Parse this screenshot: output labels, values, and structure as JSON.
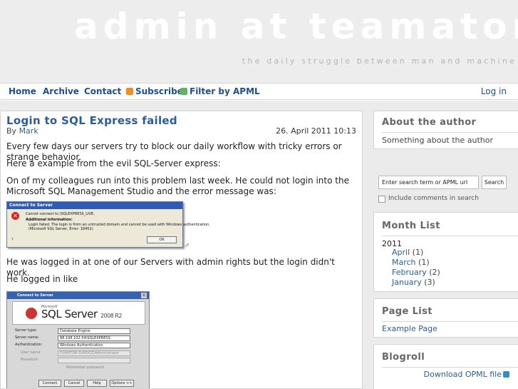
{
  "header": {
    "site_title": "admin at teamaton",
    "tagline": "the daily struggle between man and machine"
  },
  "nav": {
    "items": [
      "Home",
      "Archive",
      "Contact",
      "Subscribe",
      "Filter by APML"
    ],
    "login": "Log in"
  },
  "post": {
    "title": "Login to SQL Express failed",
    "by_label": "By",
    "author": "Mark",
    "date": "26. April 2011 10:13",
    "paragraphs": [
      "Every few days our servers try to block our daily workflow with tricky errors or strange behavior.",
      "Here a example from the evil SQL-Server express:",
      "On of my colleagues run into this problem last week. He could not login into the Microsoft SQL Management Studio and the error message was:",
      "He was logged in at one of our Servers with admin rights but the login didn't work.",
      "He logged in like"
    ],
    "screenshot1": {
      "title": "Connect to Server",
      "line1": "Cannot connect to \\SQLEXPRESS_LIVE.",
      "line2": "Additional information:",
      "line3": "Login failed. The login is from an untrusted domain and cannot be used with Windows authentication.",
      "line4": "(Microsoft SQL Server, Error: 18452)",
      "ok": "OK"
    },
    "screenshot2": {
      "title": "Connect to Server",
      "microsoft": "Microsoft",
      "product": "SQL Server",
      "version": "2008 R2",
      "rows": [
        {
          "label": "Server type:",
          "value": "Database Engine"
        },
        {
          "label": "Server name:",
          "value": "88.198.102.54\\SQLEXPRESS"
        },
        {
          "label": "Authentication:",
          "value": "Windows Authentication"
        },
        {
          "label": "User name:",
          "value": "DVANTOR-SVRDOZ\\Administrator"
        },
        {
          "label": "Password:",
          "value": ""
        },
        {
          "label": "Remember password",
          "value": ""
        }
      ],
      "buttons": [
        "Connect",
        "Cancel",
        "Help",
        "Options >>"
      ]
    }
  },
  "sidebar": {
    "about": {
      "title": "About the author",
      "text": "Something about the author"
    },
    "search": {
      "placeholder": "Enter search term or APML url",
      "button": "Search",
      "include_comments": "Include comments in search"
    },
    "month_list": {
      "title": "Month List",
      "year": "2011",
      "months": [
        {
          "name": "April",
          "count": "(1)"
        },
        {
          "name": "March",
          "count": "(1)"
        },
        {
          "name": "February",
          "count": "(2)"
        },
        {
          "name": "January",
          "count": "(3)"
        }
      ]
    },
    "page_list": {
      "title": "Page List",
      "items": [
        "Example Page"
      ]
    },
    "blogroll": {
      "title": "Blogroll",
      "download": "Download OPML file"
    }
  }
}
